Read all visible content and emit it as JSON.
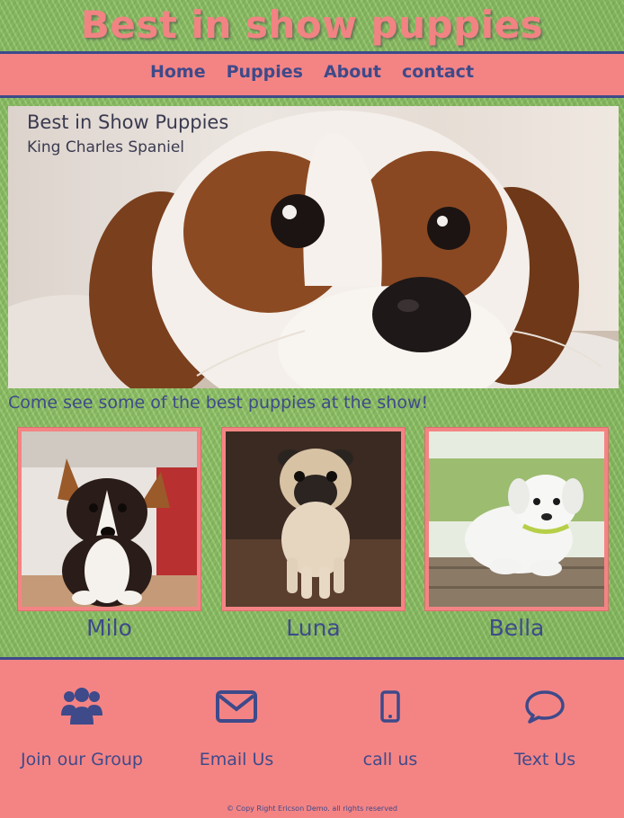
{
  "header": {
    "title": "Best in show puppies"
  },
  "nav": {
    "items": [
      "Home",
      "Puppies",
      "About",
      "contact"
    ]
  },
  "hero": {
    "title": "Best in Show Puppies",
    "subtitle": "King Charles Spaniel",
    "image_icon": "spaniel-photo"
  },
  "intro": {
    "text": "Come see some of the best puppies at the show!"
  },
  "puppies": [
    {
      "name": "Milo",
      "image_icon": "corgi-photo"
    },
    {
      "name": "Luna",
      "image_icon": "pug-photo"
    },
    {
      "name": "Bella",
      "image_icon": "labrador-photo"
    }
  ],
  "footer": {
    "contacts": [
      {
        "label": "Join our Group",
        "icon": "group-icon"
      },
      {
        "label": "Email Us",
        "icon": "envelope-icon"
      },
      {
        "label": "call us",
        "icon": "mobile-phone-icon"
      },
      {
        "label": "Text Us",
        "icon": "chat-bubble-icon"
      }
    ],
    "copyright": "© Copy Right Ericson Demo. all rights reserved"
  },
  "colors": {
    "accent_pink": "#f48484",
    "navy": "#3e4a8a",
    "grass_green": "#8fbe6a"
  }
}
